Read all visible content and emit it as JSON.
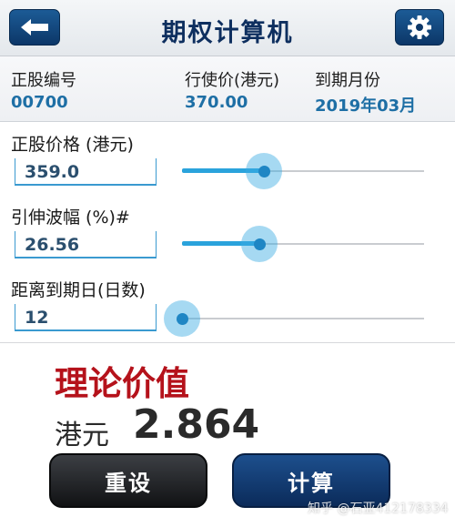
{
  "header": {
    "title": "期权计算机"
  },
  "info": {
    "code_label": "正股编号",
    "code_value": "00700",
    "strike_label": "行使价(港元)",
    "strike_value": "370.00",
    "expiry_label": "到期月份",
    "expiry_value": "2019年03月"
  },
  "inputs": {
    "price": {
      "label": "正股价格 (港元)",
      "value": "359.0",
      "slider_fraction": 0.34
    },
    "volatility": {
      "label": "引伸波幅 (%)#",
      "value": "26.56",
      "slider_fraction": 0.32
    },
    "days": {
      "label": "距离到期日(日数)",
      "value": "12",
      "slider_fraction": 0.0
    }
  },
  "result": {
    "title": "理论价值",
    "currency": "港元",
    "value": "2.864"
  },
  "buttons": {
    "reset": "重设",
    "calculate": "计算"
  },
  "watermark": "知乎 @石亚412178334",
  "colors": {
    "accent": "#2aa3dc",
    "header_button": "#0c3768",
    "result_title": "#b5121b"
  },
  "icons": {
    "back": "back-arrow-icon",
    "settings": "gear-icon"
  }
}
